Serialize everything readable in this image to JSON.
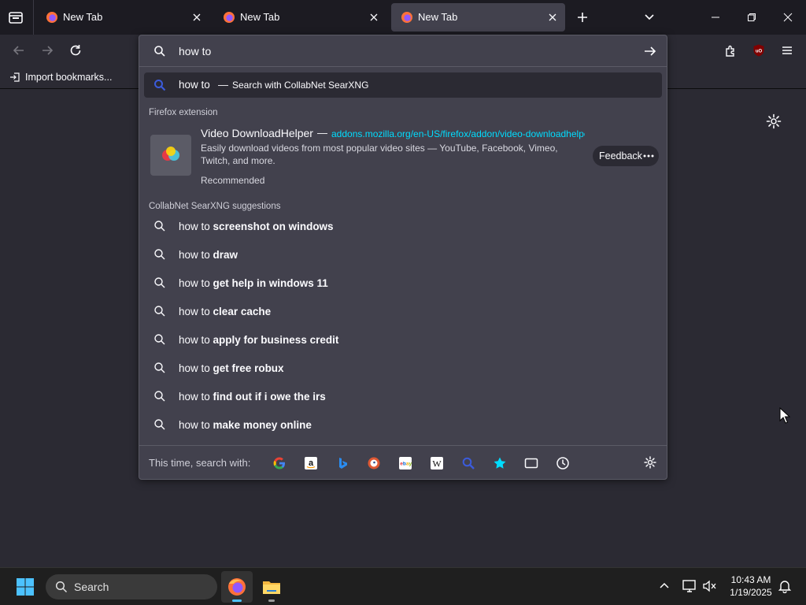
{
  "tabs": [
    {
      "title": "New Tab",
      "active": false
    },
    {
      "title": "New Tab",
      "active": false
    },
    {
      "title": "New Tab",
      "active": true
    }
  ],
  "bookmarks": {
    "import_label": "Import bookmarks..."
  },
  "urlbar": {
    "value": "how to",
    "heuristic": {
      "query": "how to",
      "separator": "—",
      "engine_label": "Search with CollabNet SearXNG"
    }
  },
  "extension_group": {
    "label": "Firefox extension",
    "name": "Video DownloadHelper",
    "separator": "—",
    "url": "addons.mozilla.org/en-US/firefox/addon/video-downloadhelper",
    "description": "Easily download videos from most popular video sites — YouTube, Facebook, Vimeo, Twitch, and more.",
    "recommended": "Recommended",
    "feedback_label": "Feedback"
  },
  "suggestions_group": {
    "label": "CollabNet SearXNG suggestions",
    "prefix": "how to",
    "items": [
      {
        "bold": "screenshot on windows"
      },
      {
        "bold": "draw"
      },
      {
        "bold": "get help in windows 11"
      },
      {
        "bold": "clear cache"
      },
      {
        "bold": "apply for business credit"
      },
      {
        "bold": "get free robux"
      },
      {
        "bold": "find out if i owe the irs"
      },
      {
        "bold": "make money online"
      }
    ]
  },
  "oneoff": {
    "label": "This time, search with:",
    "engines": [
      "google-icon",
      "amazon-icon",
      "bing-icon",
      "duckduckgo-icon",
      "ebay-icon",
      "wikipedia-icon",
      "searxng-icon",
      "bookmarks-star-icon",
      "tabs-icon",
      "history-icon"
    ]
  },
  "taskbar": {
    "search_label": "Search",
    "time": "10:43 AM",
    "date": "1/19/2025"
  },
  "colors": {
    "accent_link": "#00ddff",
    "popup_bg": "#42414d",
    "toolbar_bg": "#2b2a33",
    "tabbar_bg": "#1c1b22"
  }
}
